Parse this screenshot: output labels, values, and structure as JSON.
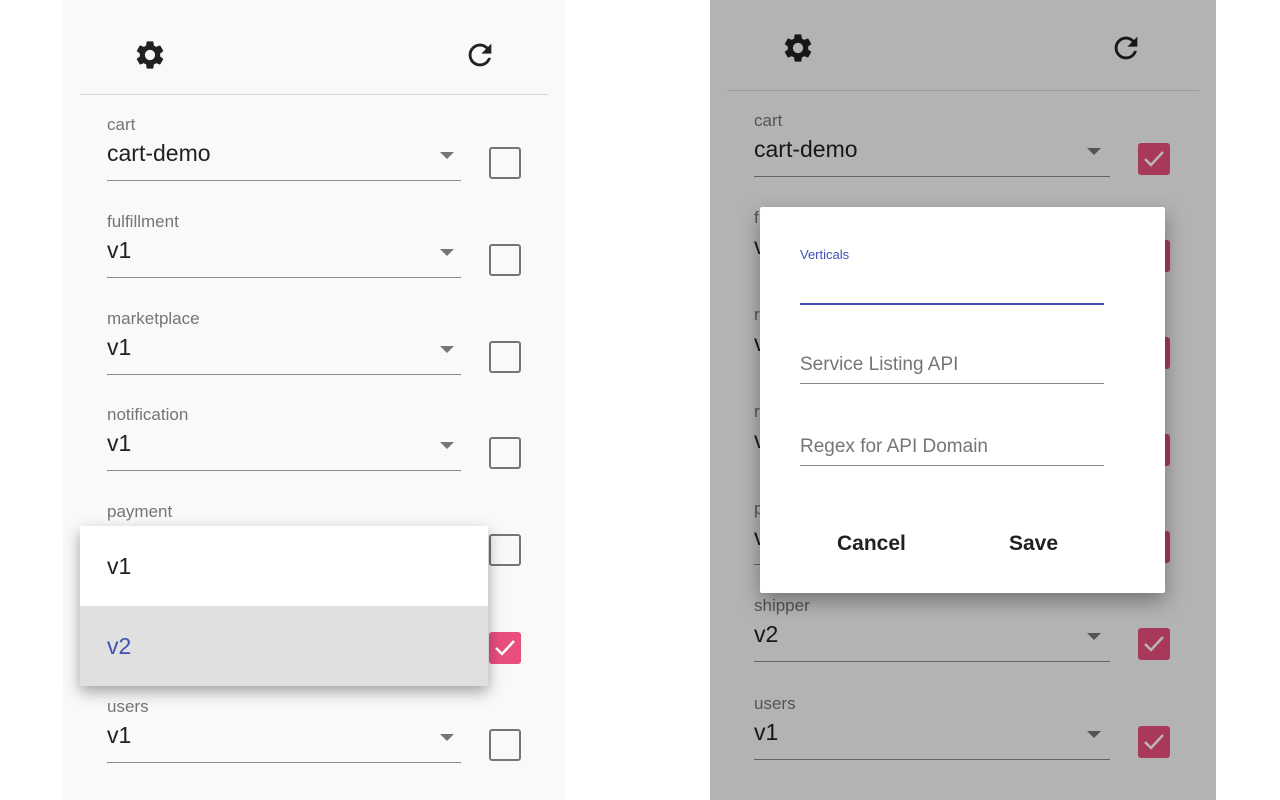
{
  "left_panel": {
    "rows": [
      {
        "label": "cart",
        "value": "cart-demo",
        "checked": false
      },
      {
        "label": "fulfillment",
        "value": "v1",
        "checked": false
      },
      {
        "label": "marketplace",
        "value": "v1",
        "checked": false
      },
      {
        "label": "notification",
        "value": "v1",
        "checked": false
      },
      {
        "label": "payment",
        "value": "",
        "checked": false
      },
      {
        "label": "",
        "value": "",
        "checked": true
      },
      {
        "label": "users",
        "value": "v1",
        "checked": false
      }
    ],
    "dropdown_options": [
      "v1",
      "v2"
    ],
    "dropdown_selected": "v2"
  },
  "right_panel": {
    "rows": [
      {
        "label": "cart",
        "value": "cart-demo",
        "checked": true
      },
      {
        "label": "f",
        "value": "v",
        "checked": true
      },
      {
        "label": "r",
        "value": "v",
        "checked": true
      },
      {
        "label": "r",
        "value": "v",
        "checked": true
      },
      {
        "label": "p",
        "value": "v",
        "checked": true
      },
      {
        "label": "shipper",
        "value": "v2",
        "checked": true
      },
      {
        "label": "users",
        "value": "v1",
        "checked": true
      }
    ],
    "dialog": {
      "verticals_label": "Verticals",
      "service_listing_placeholder": "Service Listing API",
      "regex_placeholder": "Regex for API Domain",
      "cancel_label": "Cancel",
      "save_label": "Save"
    }
  },
  "colors": {
    "accent_pink": "#e94f7e",
    "accent_blue": "#3f51b5",
    "icon": "#212121"
  },
  "icons": [
    "gear-icon",
    "refresh-icon",
    "caret-down-icon",
    "checkmark-icon"
  ]
}
